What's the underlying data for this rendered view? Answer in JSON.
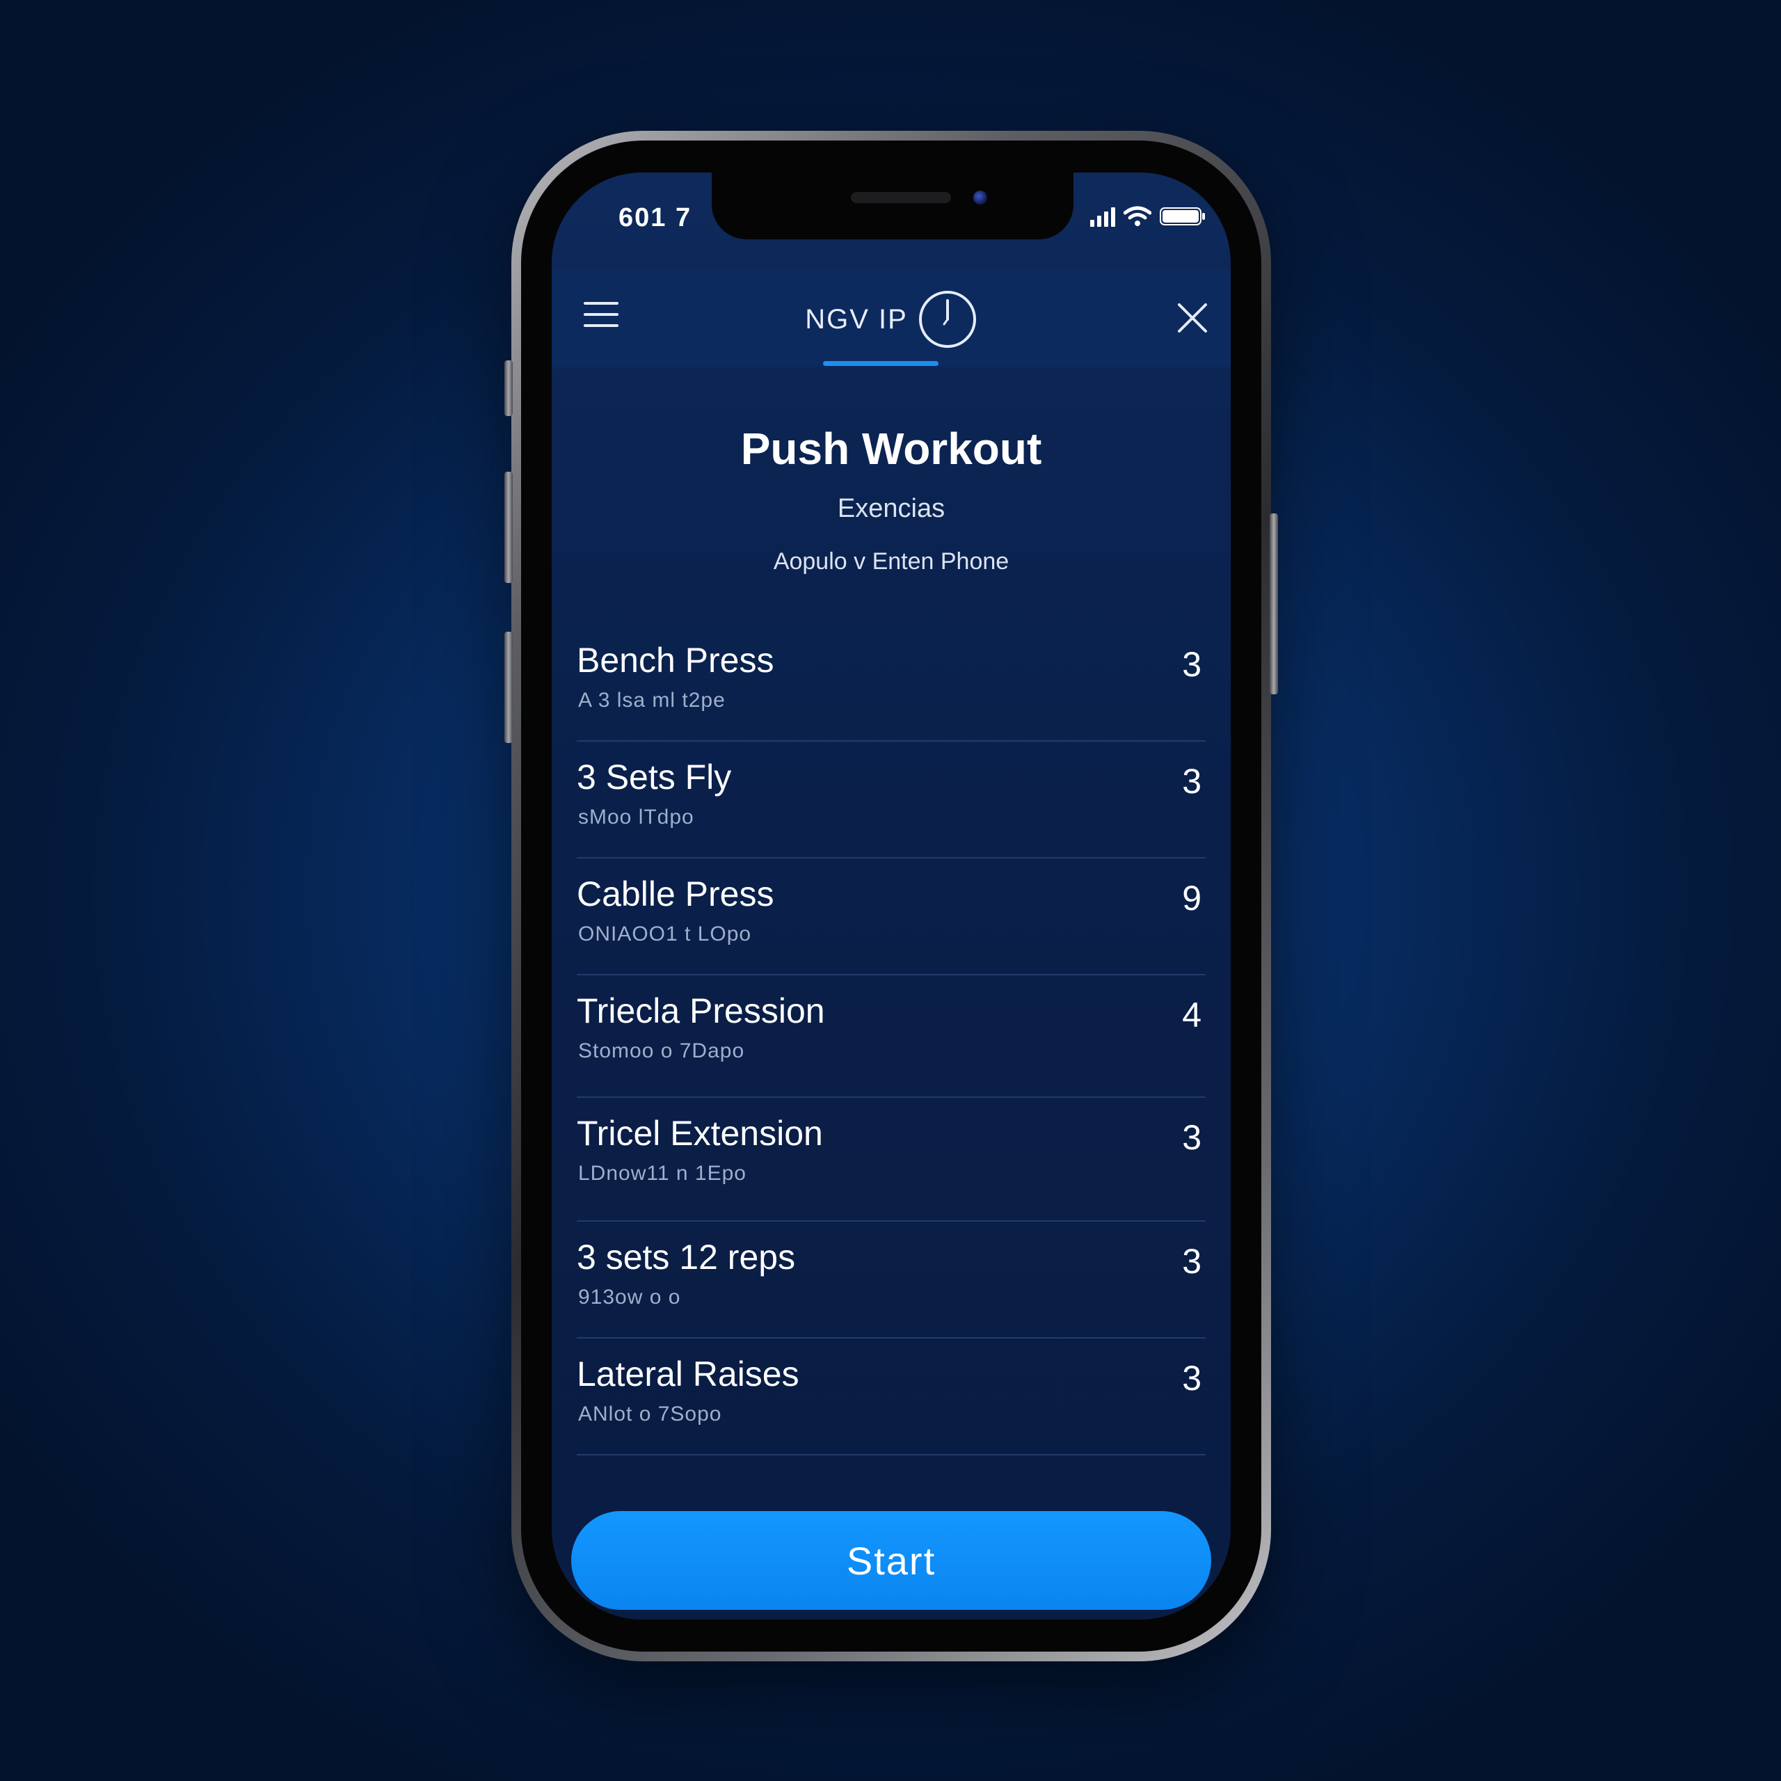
{
  "status_bar": {
    "time": "601 7",
    "signal_icon": "cellular-signal-icon",
    "wifi_icon": "wifi-icon",
    "battery_icon": "battery-icon"
  },
  "header": {
    "menu_icon": "hamburger-menu-icon",
    "title": "NGV IP",
    "timer_icon": "timer-icon",
    "close_icon": "close-icon"
  },
  "workout": {
    "title": "Push Workout",
    "subtitle": "Exencias",
    "caption": "Aopulo v Enten Phone"
  },
  "exercises": [
    {
      "name": "Bench Press",
      "detail": "A 3 lsa ml t2pe",
      "count": "3"
    },
    {
      "name": "3 Sets Fly",
      "detail": "sMoo lTdpo",
      "count": "3"
    },
    {
      "name": "Cablle Press",
      "detail": "ONIAOO1 t LOpo",
      "count": "9"
    },
    {
      "name": "Triecla Pression",
      "detail": "Stomoo o 7Dapo",
      "count": "4"
    },
    {
      "name": "Tricel Extension",
      "detail": "LDnow11 n 1Epo",
      "count": "3"
    },
    {
      "name": "3 sets 12 reps",
      "detail": "913ow o o",
      "count": "3"
    },
    {
      "name": "Lateral Raises",
      "detail": "ANlot o 7Sopo",
      "count": "3"
    }
  ],
  "actions": {
    "start_label": "Start"
  },
  "colors": {
    "background": "#041a3d",
    "screen": "#0a1f49",
    "header": "#0c2a5e",
    "accent": "#1497ff",
    "divider": "#233b6a",
    "detail_text": "#9fb0cc"
  }
}
